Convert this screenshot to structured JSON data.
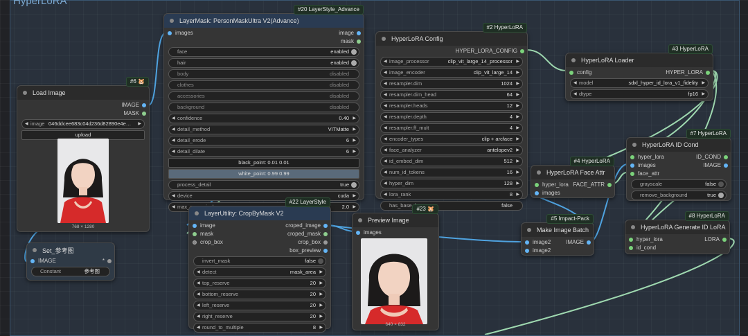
{
  "group_title": "HyperLoRA",
  "colors": {
    "image_pin": "#64b5f6",
    "green_pin": "#7bd27b",
    "mask_pin": "#8fcf8f",
    "wire_blue": "#4fa3e0",
    "wire_green": "#9fd9b0",
    "gray_pin": "#999999"
  },
  "node20": {
    "badge": "#20 LayerStyle_Advance",
    "title": "LayerMask: PersonMaskUltra V2(Advance)",
    "in_images": "images",
    "out_image": "image",
    "out_mask": "mask",
    "face": "face",
    "face_v": "enabled",
    "hair": "hair",
    "hair_v": "enabled",
    "body": "body",
    "body_v": "disabled",
    "clothes": "clothes",
    "clothes_v": "disabled",
    "accessories": "accessories",
    "accessories_v": "disabled",
    "background": "background",
    "background_v": "disabled",
    "confidence": "confidence",
    "confidence_v": "0.40",
    "detail_method": "detail_method",
    "detail_method_v": "VITMatte",
    "detail_erode": "detail_erode",
    "detail_erode_v": "6",
    "detail_dilate": "detail_dilate",
    "detail_dilate_v": "6",
    "black_point": "black_point: 0.01  0.01",
    "white_point": "white_point: 0.99  0.99",
    "process_detail": "process_detail",
    "process_detail_v": "true",
    "device": "device",
    "device_v": "cuda",
    "max_megapixels": "max_megapixels",
    "max_megapixels_v": "2.0"
  },
  "node6": {
    "badge": "#6 🐹",
    "title": "Load Image",
    "out_image": "IMAGE",
    "out_mask": "MASK",
    "image_label": "image",
    "image_value": "046ddcee683c04d236d82890e4e…",
    "upload": "upload",
    "caption": "768 × 1280"
  },
  "setnode": {
    "title": "Set_参考图",
    "pin": "IMAGE",
    "star": "*",
    "constant_label": "Constant",
    "constant_value": "参考图"
  },
  "node2": {
    "badge": "#2 HyperLoRA",
    "title": "HyperLoRA Config",
    "out": "HYPER_LORA_CONFIG",
    "rows": [
      {
        "k": "image_processor",
        "v": "clip_vit_large_14_processor"
      },
      {
        "k": "image_encoder",
        "v": "clip_vit_large_14"
      },
      {
        "k": "resampler.dim",
        "v": "1024"
      },
      {
        "k": "resampler.dim_head",
        "v": "64"
      },
      {
        "k": "resampler.heads",
        "v": "12"
      },
      {
        "k": "resampler.depth",
        "v": "4"
      },
      {
        "k": "resampler.ff_mult",
        "v": "4"
      },
      {
        "k": "encoder_types",
        "v": "clip + arcface"
      },
      {
        "k": "face_analyzer",
        "v": "antelopev2"
      },
      {
        "k": "id_embed_dim",
        "v": "512"
      },
      {
        "k": "num_id_tokens",
        "v": "16"
      },
      {
        "k": "hyper_dim",
        "v": "128"
      },
      {
        "k": "lora_rank",
        "v": "8"
      }
    ],
    "has_base_lora": "has_base_lora",
    "has_base_lora_v": "false"
  },
  "node3": {
    "badge": "#3 HyperLoRA",
    "title": "HyperLoRA Loader",
    "in": "config",
    "out": "HYPER_LORA",
    "model": "model",
    "model_v": "sdxl_hyper_id_lora_v1_fidelity",
    "dtype": "dtype",
    "dtype_v": "fp16"
  },
  "node7": {
    "badge": "#7 HyperLoRA",
    "title": "HyperLoRA ID Cond",
    "in1": "hyper_lora",
    "in2": "images",
    "in3": "face_attr",
    "out1": "ID_COND",
    "out2": "IMAGE",
    "grayscale": "grayscale",
    "grayscale_v": "false",
    "remove_background": "remove_background",
    "remove_background_v": "true"
  },
  "node4": {
    "badge": "#4 HyperLoRA",
    "title": "HyperLoRA Face Attr",
    "in1": "hyper_lora",
    "in2": "images",
    "out": "FACE_ATTR"
  },
  "node22": {
    "badge": "#22 LayerStyle",
    "title": "LayerUtility: CropByMask V2",
    "in1": "image",
    "in2": "mask",
    "in3": "crop_box",
    "out1": "croped_image",
    "out2": "croped_mask",
    "out3": "crop_box",
    "out4": "box_preview",
    "invert_mask": "invert_mask",
    "invert_mask_v": "false",
    "detect": "detect",
    "detect_v": "mask_area",
    "top_reserve": "top_reserve",
    "top_reserve_v": "20",
    "bottom_reserve": "bottom_reserve",
    "bottom_reserve_v": "20",
    "left_reserve": "left_reserve",
    "left_reserve_v": "20",
    "right_reserve": "right_reserve",
    "right_reserve_v": "20",
    "round_to_multiple": "round_to_multiple",
    "round_to_multiple_v": "8"
  },
  "node23": {
    "badge": "#23 🐹",
    "title": "Preview Image",
    "in": "images",
    "caption": "640 × 832"
  },
  "node5": {
    "badge": "#5 Impact-Pack",
    "title": "Make Image Batch",
    "in1": "image2",
    "in2": "image2",
    "out": "IMAGE"
  },
  "node8": {
    "badge": "#8 HyperLoRA",
    "title": "HyperLoRA Generate ID LoRA",
    "in1": "hyper_lora",
    "in2": "id_cond",
    "out": "LORA"
  }
}
